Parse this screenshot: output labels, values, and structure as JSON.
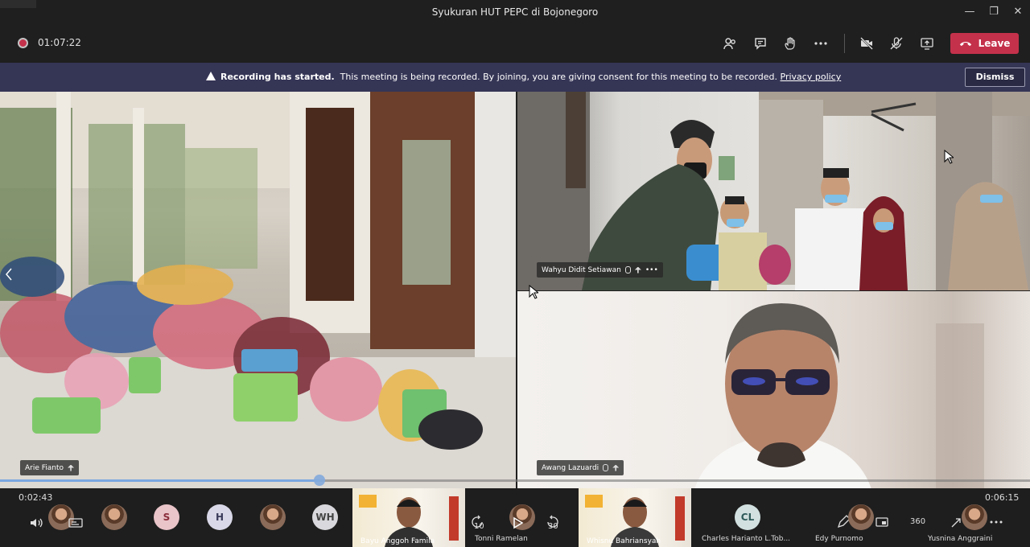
{
  "window": {
    "title": "Syukuran HUT PEPC di Bojonegoro",
    "minimize": "—",
    "restore": "❐",
    "close": "✕"
  },
  "toolbar": {
    "recording_time": "01:07:22",
    "leave_label": "Leave",
    "icons": [
      "participants-icon",
      "chat-icon",
      "raise-hand-icon",
      "more-options-icon",
      "camera-off-icon",
      "mic-off-icon",
      "share-screen-icon"
    ]
  },
  "banner": {
    "bold": "Recording has started.",
    "text": "This meeting is being recorded. By joining, you are giving consent for this meeting to be recorded.",
    "link": "Privacy policy",
    "dismiss_label": "Dismiss"
  },
  "tiles": {
    "main": {
      "name": "Arie Fianto"
    },
    "top_right": {
      "name": "Wahyu Didit Setiawan",
      "more": "•••"
    },
    "bottom_right": {
      "name": "Awang Lazuardi"
    }
  },
  "playback": {
    "elapsed": "0:02:43",
    "total": "0:06:15",
    "progress_fraction": 0.31,
    "rewind_label": "10",
    "forward_label": "30"
  },
  "participants_strip": {
    "letters": [
      "S",
      "H",
      "WH",
      "CL"
    ],
    "names": {
      "bayu": "Bayu Anggoh Famila",
      "tonni": "Tonni Ramelan",
      "whisnu": "Whisnu Bahriansyah",
      "charles": "Charles Harianto L.Tob...",
      "edy": "Edy Purnomo",
      "yusnina": "Yusnina Anggraini"
    },
    "zoom_label": "360"
  },
  "colors": {
    "leave": "#c4314b",
    "banner": "#353556",
    "progress": "#7aa7e0"
  }
}
